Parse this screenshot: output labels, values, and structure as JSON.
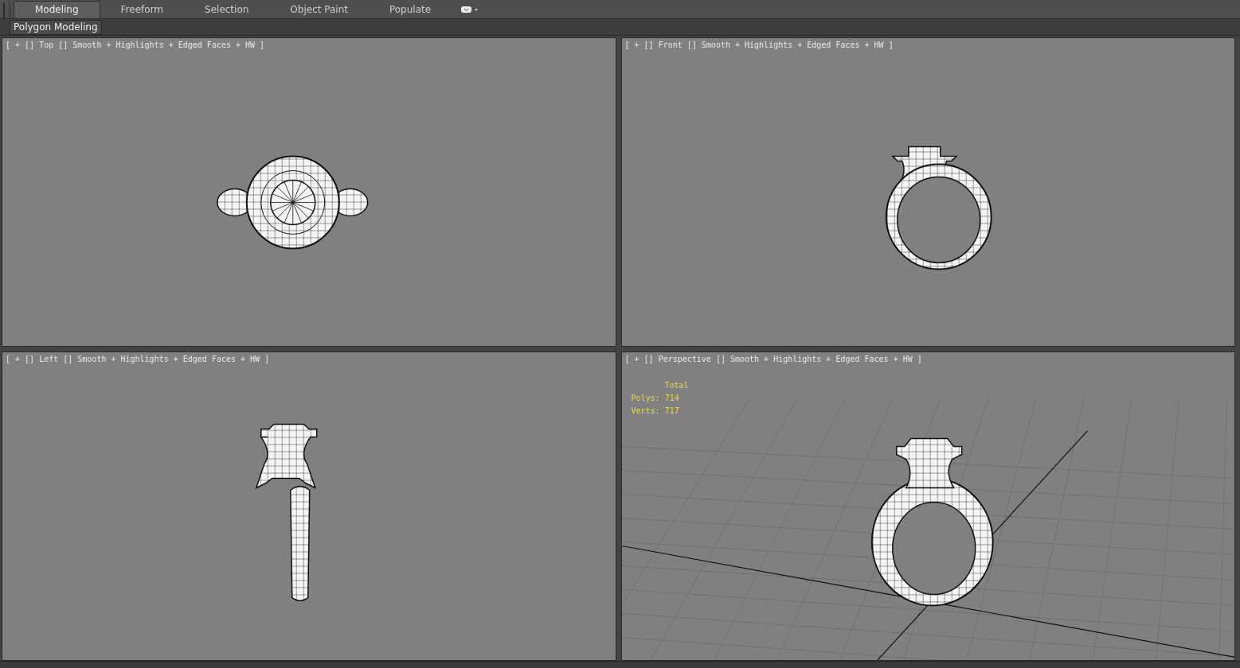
{
  "ribbon": {
    "tabs": [
      {
        "label": "Modeling",
        "selected": true
      },
      {
        "label": "Freeform",
        "selected": false
      },
      {
        "label": "Selection",
        "selected": false
      },
      {
        "label": "Object Paint",
        "selected": false
      },
      {
        "label": "Populate",
        "selected": false
      }
    ],
    "panel_tab": "Polygon Modeling"
  },
  "viewports": [
    {
      "kind": "top",
      "label": "[ + [] Top [] Smooth + Highlights + Edged Faces + HW ]"
    },
    {
      "kind": "front",
      "label": "[ + [] Front [] Smooth + Highlights + Edged Faces + HW ]"
    },
    {
      "kind": "left",
      "label": "[ + [] Left [] Smooth + Highlights + Edged Faces + HW ]"
    },
    {
      "kind": "perspective",
      "label": "[ + [] Perspective [] Smooth + Highlights + Edged Faces + HW ]",
      "stats": {
        "title": "Total",
        "lines": [
          {
            "name": "Polys:",
            "value": "714"
          },
          {
            "name": "Verts:",
            "value": "717"
          }
        ]
      }
    }
  ]
}
